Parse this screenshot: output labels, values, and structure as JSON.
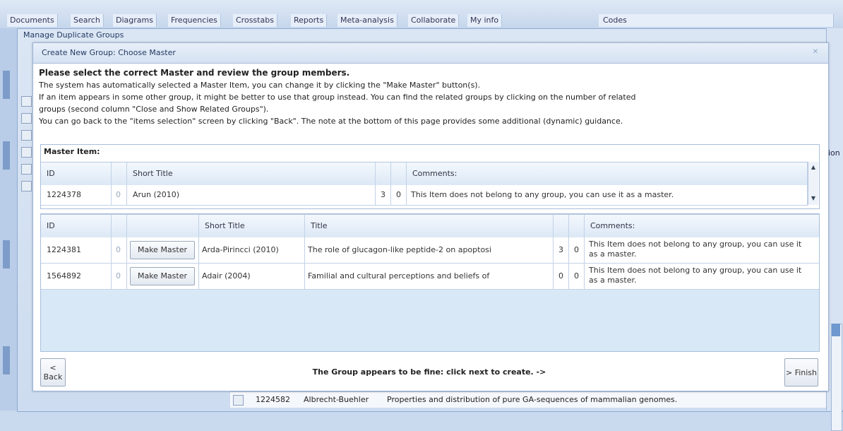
{
  "tabs": [
    {
      "label": "Documents"
    },
    {
      "label": "Search"
    },
    {
      "label": "Diagrams"
    },
    {
      "label": "Frequencies"
    },
    {
      "label": "Crosstabs"
    },
    {
      "label": "Reports"
    },
    {
      "label": "Meta-analysis"
    },
    {
      "label": "Collaborate"
    },
    {
      "label": "My info"
    },
    {
      "label": "Codes"
    }
  ],
  "outer_dialog": {
    "title": "Manage Duplicate Groups"
  },
  "inner_dialog": {
    "title": "Create New Group: Choose Master",
    "heading": "Please select the correct Master and review the group members.",
    "instructions": [
      "The system has automatically selected a Master Item, you can change it by clicking the \"Make Master\" button(s).",
      "If an item appears in some other group, it might be better to use that group instead. You can find the related groups by clicking on the number of related",
      "groups (second column \"Close and Show Related Groups\").",
      "You can go back to the \"items selection\" screen by clicking \"Back\". The note at the bottom of this page provides some additional (dynamic) guidance."
    ]
  },
  "master": {
    "label": "Master Item:",
    "headers": {
      "id": "ID",
      "short_title": "Short Title",
      "comments": "Comments:"
    },
    "row": {
      "id": "1224378",
      "related": "0",
      "short_title": "Arun (2010)",
      "c1": "3",
      "c2": "0",
      "comments": "This Item does not belong to any group, you can use it as a master."
    }
  },
  "members": {
    "headers": {
      "id": "ID",
      "short_title": "Short Title",
      "title": "Title",
      "comments": "Comments:"
    },
    "make_master_label": "Make Master",
    "rows": [
      {
        "id": "1224381",
        "related": "0",
        "short_title": "Arda-Pirincci (2010)",
        "title": "The role of glucagon-like peptide-2 on apoptosi",
        "c1": "3",
        "c2": "0",
        "comments": "This Item does not belong to any group, you can use it as a master."
      },
      {
        "id": "1564892",
        "related": "0",
        "short_title": "Adair (2004)",
        "title": "Familial and cultural perceptions and beliefs of",
        "c1": "0",
        "c2": "0",
        "comments": "This Item does not belong to any group, you can use it as a master."
      }
    ]
  },
  "footer": {
    "back_label": "< Back",
    "message": "The Group appears to be fine: click next to create. ->",
    "finish_label": "> Finish"
  },
  "background": {
    "right_partial_label": "ion",
    "row": {
      "id": "1224582",
      "short_title": "Albrecht-Buehler",
      "title": "Properties and distribution of pure GA-sequences of mammalian genomes."
    }
  }
}
